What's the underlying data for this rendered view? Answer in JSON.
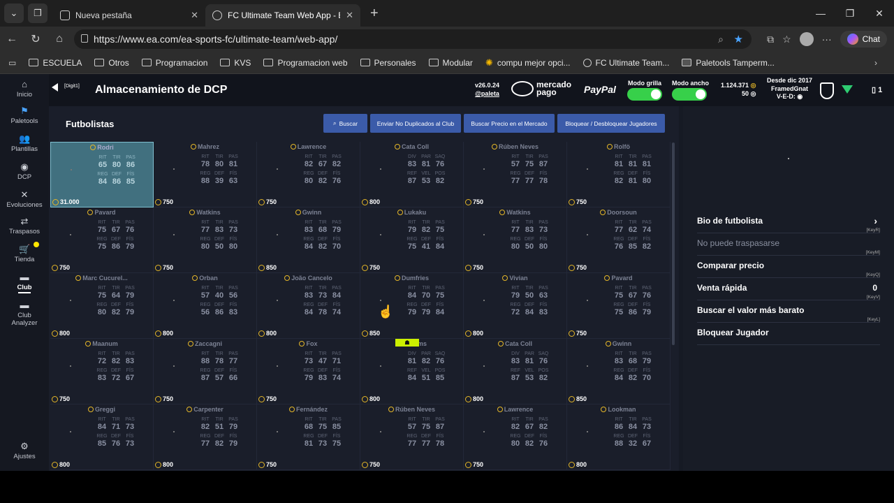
{
  "browser": {
    "tabs": [
      {
        "title": "Nueva pestaña",
        "active": false
      },
      {
        "title": "FC Ultimate Team Web App - EA S",
        "active": true
      }
    ],
    "url": "https://www.ea.com/ea-sports-fc/ultimate-team/web-app/",
    "chat_label": "Chat",
    "bookmarks": [
      {
        "label": "ESCUELA",
        "icon": "folder-icon"
      },
      {
        "label": "Otros",
        "icon": "folder-icon"
      },
      {
        "label": "Programacion",
        "icon": "folder-icon"
      },
      {
        "label": "KVS",
        "icon": "folder-icon"
      },
      {
        "label": "Programacion web",
        "icon": "folder-icon"
      },
      {
        "label": "Personales",
        "icon": "folder-icon"
      },
      {
        "label": "Modular",
        "icon": "folder-icon"
      },
      {
        "label": "compu mejor opci...",
        "icon": "sun-icon"
      },
      {
        "label": "FC Ultimate Team...",
        "icon": "ea-icon"
      },
      {
        "label": "Paletools Tamperm...",
        "icon": "ext-icon"
      }
    ]
  },
  "sidebar": {
    "items": [
      {
        "label": "Inicio",
        "icon": "home-icon"
      },
      {
        "label": "Paletools",
        "icon": "paletools-icon"
      },
      {
        "label": "Plantillas",
        "icon": "squad-icon"
      },
      {
        "label": "DCP",
        "icon": "sbc-icon"
      },
      {
        "label": "Evoluciones",
        "icon": "evolution-icon"
      },
      {
        "label": "Traspasos",
        "icon": "transfer-icon"
      },
      {
        "label": "Tienda",
        "icon": "cart-icon"
      },
      {
        "label": "Club",
        "icon": "club-icon"
      },
      {
        "label": "Club Analyzer",
        "icon": "analyzer-icon"
      },
      {
        "label": "Ajustes",
        "icon": "gear-icon"
      }
    ]
  },
  "header": {
    "digit_tag": "[Digit1]",
    "title": "Almacenamiento de DCP",
    "version": "v26.0.24",
    "author": "@paleta",
    "mercado_pago": [
      "mercado",
      "pago"
    ],
    "paypal": "PayPal",
    "toggle_grid_label": "Modo grilla",
    "toggle_wide_label": "Modo ancho",
    "coins": "1.124.371",
    "points": "50",
    "since": "Desde dic 2017",
    "club_name": "FramedGnat",
    "ved": "V-E-D:",
    "slot_count": "1"
  },
  "main": {
    "section_title": "Futbolistas",
    "buttons": [
      "Buscar",
      "Enviar No Duplicados al Club",
      "Buscar Precio en el Mercado",
      "Bloquear / Desbloquear Jugadores"
    ],
    "cards": [
      {
        "name": "Rodri",
        "labels": [
          "RIT",
          "TIR",
          "PAS",
          "REG",
          "DEF",
          "FÍS"
        ],
        "values": [
          "65",
          "80",
          "86",
          "84",
          "86",
          "85"
        ],
        "price": "31.000",
        "selected": true
      },
      {
        "name": "Mahrez",
        "labels": [
          "RIT",
          "TIR",
          "PAS",
          "REG",
          "DEF",
          "FÍS"
        ],
        "values": [
          "78",
          "80",
          "81",
          "88",
          "39",
          "63"
        ],
        "price": "750"
      },
      {
        "name": "Lawrence",
        "labels": [
          "RIT",
          "TIR",
          "PAS",
          "REG",
          "DEF",
          "FÍS"
        ],
        "values": [
          "82",
          "67",
          "82",
          "80",
          "82",
          "76"
        ],
        "price": "750"
      },
      {
        "name": "Cata Coll",
        "labels": [
          "DIV",
          "PAR",
          "SAQ",
          "REF",
          "VEL",
          "POS"
        ],
        "values": [
          "83",
          "81",
          "76",
          "87",
          "53",
          "82"
        ],
        "price": "800"
      },
      {
        "name": "Rúben Neves",
        "labels": [
          "RIT",
          "TIR",
          "PAS",
          "REG",
          "DEF",
          "FÍS"
        ],
        "values": [
          "57",
          "75",
          "87",
          "77",
          "77",
          "78"
        ],
        "price": "750"
      },
      {
        "name": "Rolfö",
        "labels": [
          "RIT",
          "TIR",
          "PAS",
          "REG",
          "DEF",
          "FÍS"
        ],
        "values": [
          "81",
          "81",
          "81",
          "82",
          "81",
          "80"
        ],
        "price": "750"
      },
      {
        "name": "Pavard",
        "labels": [
          "RIT",
          "TIR",
          "PAS",
          "REG",
          "DEF",
          "FÍS"
        ],
        "values": [
          "75",
          "67",
          "76",
          "75",
          "86",
          "79"
        ],
        "price": "750"
      },
      {
        "name": "Watkins",
        "labels": [
          "RIT",
          "TIR",
          "PAS",
          "REG",
          "DEF",
          "FÍS"
        ],
        "values": [
          "77",
          "83",
          "73",
          "80",
          "50",
          "80"
        ],
        "price": "750"
      },
      {
        "name": "Gwinn",
        "labels": [
          "RIT",
          "TIR",
          "PAS",
          "REG",
          "DEF",
          "FÍS"
        ],
        "values": [
          "83",
          "68",
          "79",
          "84",
          "82",
          "70"
        ],
        "price": "850"
      },
      {
        "name": "Lukaku",
        "labels": [
          "RIT",
          "TIR",
          "PAS",
          "REG",
          "DEF",
          "FÍS"
        ],
        "values": [
          "79",
          "82",
          "75",
          "75",
          "41",
          "84"
        ],
        "price": "750"
      },
      {
        "name": "Watkins",
        "labels": [
          "RIT",
          "TIR",
          "PAS",
          "REG",
          "DEF",
          "FÍS"
        ],
        "values": [
          "77",
          "83",
          "73",
          "80",
          "50",
          "80"
        ],
        "price": "750"
      },
      {
        "name": "Doorsoun",
        "labels": [
          "RIT",
          "TIR",
          "PAS",
          "REG",
          "DEF",
          "FÍS"
        ],
        "values": [
          "77",
          "62",
          "74",
          "76",
          "85",
          "82"
        ],
        "price": "750"
      },
      {
        "name": "Marc Cucurel...",
        "labels": [
          "RIT",
          "TIR",
          "PAS",
          "REG",
          "DEF",
          "FÍS"
        ],
        "values": [
          "75",
          "64",
          "79",
          "80",
          "82",
          "79"
        ],
        "price": "800"
      },
      {
        "name": "Orban",
        "labels": [
          "RIT",
          "TIR",
          "PAS",
          "REG",
          "DEF",
          "FÍS"
        ],
        "values": [
          "57",
          "40",
          "56",
          "56",
          "86",
          "83"
        ],
        "price": "800"
      },
      {
        "name": "João Cancelo",
        "labels": [
          "RIT",
          "TIR",
          "PAS",
          "REG",
          "DEF",
          "FÍS"
        ],
        "values": [
          "83",
          "73",
          "84",
          "84",
          "78",
          "74"
        ],
        "price": "800"
      },
      {
        "name": "Dumfries",
        "labels": [
          "RIT",
          "TIR",
          "PAS",
          "REG",
          "DEF",
          "FÍS"
        ],
        "values": [
          "84",
          "70",
          "75",
          "79",
          "79",
          "84"
        ],
        "price": "850"
      },
      {
        "name": "Vivian",
        "labels": [
          "RIT",
          "TIR",
          "PAS",
          "REG",
          "DEF",
          "FÍS"
        ],
        "values": [
          "79",
          "50",
          "63",
          "72",
          "84",
          "83"
        ],
        "price": "800"
      },
      {
        "name": "Pavard",
        "labels": [
          "RIT",
          "TIR",
          "PAS",
          "REG",
          "DEF",
          "FÍS"
        ],
        "values": [
          "75",
          "67",
          "76",
          "75",
          "86",
          "79"
        ],
        "price": "750"
      },
      {
        "name": "Maanum",
        "labels": [
          "RIT",
          "TIR",
          "PAS",
          "REG",
          "DEF",
          "FÍS"
        ],
        "values": [
          "72",
          "82",
          "83",
          "83",
          "72",
          "67"
        ],
        "price": "750"
      },
      {
        "name": "Zaccagni",
        "labels": [
          "RIT",
          "TIR",
          "PAS",
          "REG",
          "DEF",
          "FÍS"
        ],
        "values": [
          "88",
          "78",
          "77",
          "87",
          "57",
          "66"
        ],
        "price": "750"
      },
      {
        "name": "Fox",
        "labels": [
          "RIT",
          "TIR",
          "PAS",
          "REG",
          "DEF",
          "FÍS"
        ],
        "values": [
          "73",
          "47",
          "71",
          "79",
          "83",
          "74"
        ],
        "price": "750"
      },
      {
        "name": "Frohms",
        "labels": [
          "DIV",
          "PAR",
          "SAQ",
          "REF",
          "VEL",
          "POS"
        ],
        "values": [
          "81",
          "82",
          "76",
          "84",
          "51",
          "85"
        ],
        "price": "800",
        "badge": true
      },
      {
        "name": "Cata Coll",
        "labels": [
          "DIV",
          "PAR",
          "SAQ",
          "REF",
          "VEL",
          "POS"
        ],
        "values": [
          "83",
          "81",
          "76",
          "87",
          "53",
          "82"
        ],
        "price": "800"
      },
      {
        "name": "Gwinn",
        "labels": [
          "RIT",
          "TIR",
          "PAS",
          "REG",
          "DEF",
          "FÍS"
        ],
        "values": [
          "83",
          "68",
          "79",
          "84",
          "82",
          "70"
        ],
        "price": "850"
      },
      {
        "name": "Greggi",
        "labels": [
          "RIT",
          "TIR",
          "PAS",
          "REG",
          "DEF",
          "FÍS"
        ],
        "values": [
          "84",
          "71",
          "73",
          "85",
          "76",
          "73"
        ],
        "price": "800"
      },
      {
        "name": "Carpenter",
        "labels": [
          "RIT",
          "TIR",
          "PAS",
          "REG",
          "DEF",
          "FÍS"
        ],
        "values": [
          "82",
          "51",
          "79",
          "77",
          "82",
          "79"
        ],
        "price": "800"
      },
      {
        "name": "Fernández",
        "labels": [
          "RIT",
          "TIR",
          "PAS",
          "REG",
          "DEF",
          "FÍS"
        ],
        "values": [
          "68",
          "75",
          "85",
          "81",
          "73",
          "75"
        ],
        "price": "750"
      },
      {
        "name": "Rúben Neves",
        "labels": [
          "RIT",
          "TIR",
          "PAS",
          "REG",
          "DEF",
          "FÍS"
        ],
        "values": [
          "57",
          "75",
          "87",
          "77",
          "77",
          "78"
        ],
        "price": "750"
      },
      {
        "name": "Lawrence",
        "labels": [
          "RIT",
          "TIR",
          "PAS",
          "REG",
          "DEF",
          "FÍS"
        ],
        "values": [
          "82",
          "67",
          "82",
          "80",
          "82",
          "76"
        ],
        "price": "750"
      },
      {
        "name": "Lookman",
        "labels": [
          "RIT",
          "TIR",
          "PAS",
          "REG",
          "DEF",
          "FÍS"
        ],
        "values": [
          "86",
          "84",
          "73",
          "88",
          "32",
          "67"
        ],
        "price": "800"
      }
    ]
  },
  "panel": {
    "items": [
      {
        "label": "Bio de futbolista",
        "key": "",
        "enabled": true,
        "chevron": true
      },
      {
        "label": "No puede traspasarse",
        "key": "[KeyR]",
        "enabled": false
      },
      {
        "label": "Comparar precio",
        "key": "[KeyM]",
        "enabled": true
      },
      {
        "label": "Venta rápida",
        "key": "[KeyQ]",
        "enabled": true,
        "value": "0"
      },
      {
        "label": "Buscar el valor más barato",
        "key": "[KeyV]",
        "enabled": true
      },
      {
        "label": "Bloquear Jugador",
        "key": "[KeyL]",
        "enabled": true
      }
    ]
  }
}
